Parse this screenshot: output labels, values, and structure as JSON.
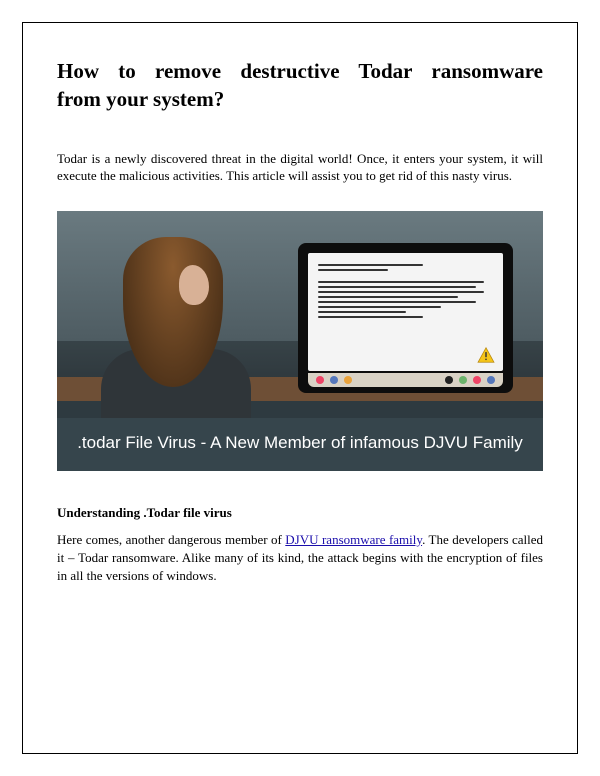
{
  "title_line1": "How to remove destructive Todar ransomware",
  "title_line2": "from your system?",
  "intro": "Todar is a newly discovered threat in the digital world! Once, it enters your system, it will execute the malicious activities. This article will assist you to get rid of this nasty virus.",
  "hero_caption": ".todar File Virus - A New Member of infamous DJVU Family",
  "section_heading": "Understanding .Todar file virus",
  "body_before_link": "Here comes, another dangerous member of ",
  "link_text": "DJVU ransomware family",
  "body_after_link": ". The developers called it – Todar ransomware. Alike many of its kind, the attack begins with the encryption of files in all the versions of windows."
}
